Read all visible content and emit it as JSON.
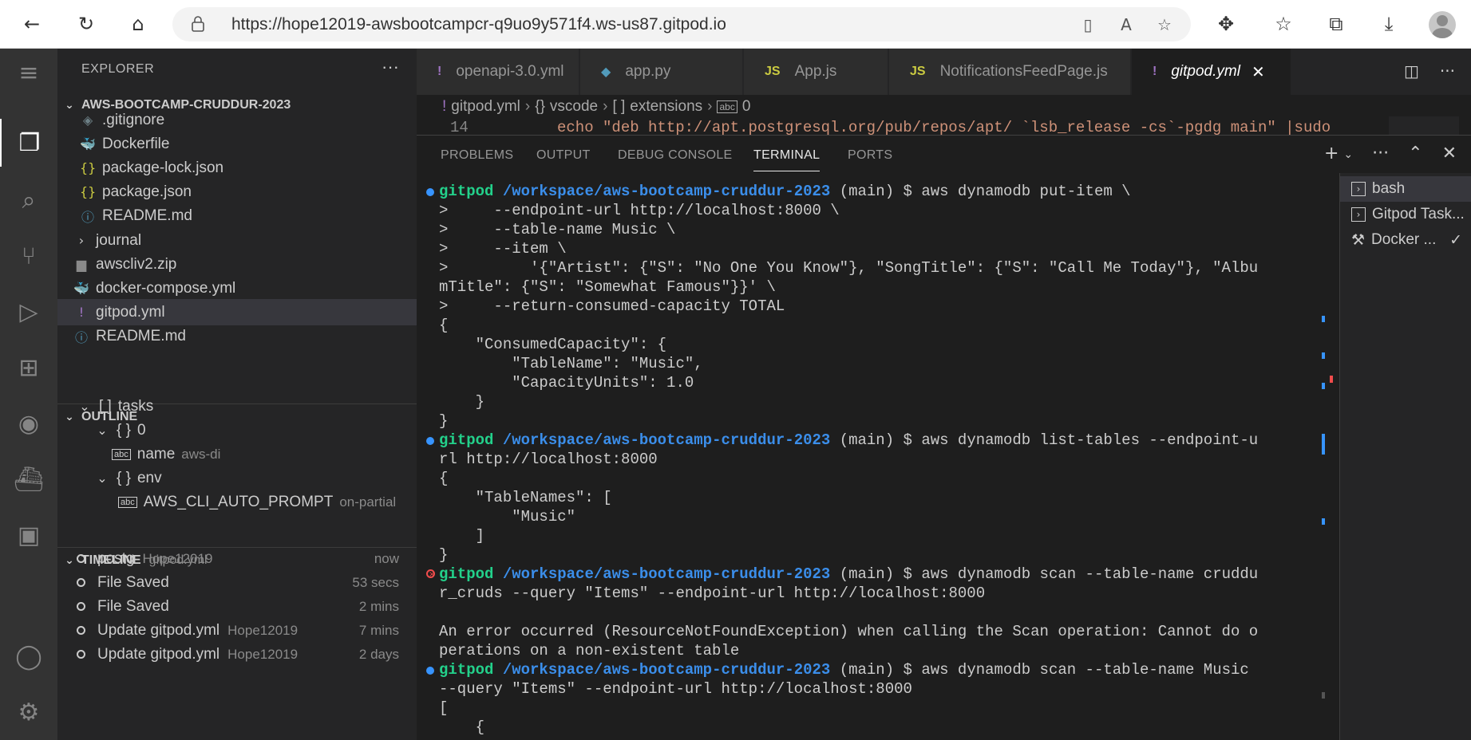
{
  "browser": {
    "url": "https://hope12019-awsbootcampcr-q9uo9y571f4.ws-us87.gitpod.io",
    "icons": [
      "back-icon",
      "refresh-icon",
      "home-icon",
      "lock-icon",
      "tab-icon",
      "read-aloud-icon",
      "add-favorite-icon",
      "extensions-icon",
      "favorites-icon",
      "collections-icon",
      "downloads-icon",
      "profile-avatar"
    ]
  },
  "activity_bar": {
    "icons": [
      "menu-icon",
      "explorer-icon",
      "search-icon",
      "source-control-icon",
      "run-debug-icon",
      "extensions-icon",
      "github-icon",
      "docker-icon",
      "api-icon",
      "account-icon",
      "settings-icon"
    ]
  },
  "sidebar": {
    "title": "EXPLORER",
    "more": "···",
    "root": "AWS-BOOTCAMP-CRUDDUR-2023",
    "files": [
      {
        "name": ".gitignore",
        "icon": "◈",
        "color": "#6d8086"
      },
      {
        "name": "Dockerfile",
        "icon": "🐳",
        "color": "#519aba"
      },
      {
        "name": "package-lock.json",
        "icon": "{}",
        "color": "#cbcb41"
      },
      {
        "name": "package.json",
        "icon": "{}",
        "color": "#cbcb41"
      },
      {
        "name": "README.md",
        "icon": "ⓘ",
        "color": "#519aba"
      },
      {
        "name": "journal",
        "icon": "›",
        "color": "#cccccc"
      },
      {
        "name": "awscliv2.zip",
        "icon": "▆",
        "color": "#8a8a8a"
      },
      {
        "name": "docker-compose.yml",
        "icon": "🐳",
        "color": "#e06c9f"
      },
      {
        "name": "gitpod.yml",
        "icon": "!",
        "color": "#a074c4"
      },
      {
        "name": "README.md",
        "icon": "ⓘ",
        "color": "#519aba"
      }
    ],
    "outline": {
      "title": "OUTLINE",
      "items": [
        {
          "label": "tasks",
          "prefix": "[ ]",
          "desc": ""
        },
        {
          "label": "0",
          "prefix": "{ }",
          "desc": ""
        },
        {
          "label": "name",
          "prefix": "abc",
          "desc": "aws-di"
        },
        {
          "label": "env",
          "prefix": "{ }",
          "desc": ""
        },
        {
          "label": "AWS_CLI_AUTO_PROMPT",
          "prefix": "abc",
          "desc": "on-partial"
        }
      ]
    },
    "timeline": {
      "title": "TIMELINE",
      "file": "gitpod.yml",
      "items": [
        {
          "label": "postg",
          "author": "Hope12019",
          "when": "now"
        },
        {
          "label": "File Saved",
          "author": "",
          "when": "53 secs"
        },
        {
          "label": "File Saved",
          "author": "",
          "when": "2 mins"
        },
        {
          "label": "Update gitpod.yml",
          "author": "Hope12019",
          "when": "7 mins"
        },
        {
          "label": "Update gitpod.yml",
          "author": "Hope12019",
          "when": "2 days"
        }
      ]
    }
  },
  "editor": {
    "tabs": [
      {
        "label": "openapi-3.0.yml",
        "icon": "!",
        "color": "#a074c4"
      },
      {
        "label": "app.py",
        "icon": "◆",
        "color": "#519aba"
      },
      {
        "label": "App.js",
        "icon": "JS",
        "color": "#cbcb41"
      },
      {
        "label": "NotificationsFeedPage.js",
        "icon": "JS",
        "color": "#cbcb41"
      },
      {
        "label": "gitpod.yml",
        "icon": "!",
        "color": "#a074c4"
      }
    ],
    "close_glyph": "✕",
    "breadcrumb": [
      "gitpod.yml",
      "vscode",
      "extensions",
      "0"
    ],
    "breadcrumb_icons": [
      "!",
      "{}",
      "[ ]",
      "abc"
    ],
    "line_number": "14",
    "line_text": "echo \"deb http://apt.postgresql.org/pub/repos/apt/ `lsb_release -cs`-pgdg main\" |sudo"
  },
  "panel": {
    "tabs": [
      "PROBLEMS",
      "OUTPUT",
      "DEBUG CONSOLE",
      "TERMINAL",
      "PORTS"
    ],
    "active_tab": "TERMINAL",
    "terminals": [
      {
        "label": "bash"
      },
      {
        "label": "Gitpod Task..."
      },
      {
        "label": "Docker ..."
      }
    ]
  },
  "terminal": {
    "prompt_user": "gitpod",
    "prompt_path": "/workspace/aws-bootcamp-cruddur-2023",
    "prompt_branch": " (main) $ ",
    "lines": [
      {
        "mark": "ok",
        "cmd": "aws dynamodb put-item \\"
      },
      {
        "text": ">     --endpoint-url http://localhost:8000 \\"
      },
      {
        "text": ">     --table-name Music \\"
      },
      {
        "text": ">     --item \\"
      },
      {
        "text": ">         '{\"Artist\": {\"S\": \"No One You Know\"}, \"SongTitle\": {\"S\": \"Call Me Today\"}, \"Albu"
      },
      {
        "text": "mTitle\": {\"S\": \"Somewhat Famous\"}}' \\"
      },
      {
        "text": ">     --return-consumed-capacity TOTAL"
      },
      {
        "text": "{"
      },
      {
        "text": "    \"ConsumedCapacity\": {"
      },
      {
        "text": "        \"TableName\": \"Music\","
      },
      {
        "text": "        \"CapacityUnits\": 1.0"
      },
      {
        "text": "    }"
      },
      {
        "text": "}"
      },
      {
        "mark": "ok",
        "cmd": "aws dynamodb list-tables --endpoint-u"
      },
      {
        "text": "rl http://localhost:8000"
      },
      {
        "text": "{"
      },
      {
        "text": "    \"TableNames\": ["
      },
      {
        "text": "        \"Music\""
      },
      {
        "text": "    ]"
      },
      {
        "text": "}"
      },
      {
        "mark": "err",
        "cmd": "aws dynamodb scan --table-name cruddu"
      },
      {
        "text": "r_cruds --query \"Items\" --endpoint-url http://localhost:8000"
      },
      {
        "text": ""
      },
      {
        "text": "An error occurred (ResourceNotFoundException) when calling the Scan operation: Cannot do o"
      },
      {
        "text": "perations on a non-existent table"
      },
      {
        "mark": "ok",
        "cmd": "aws dynamodb scan --table-name Music"
      },
      {
        "text": "--query \"Items\" --endpoint-url http://localhost:8000"
      },
      {
        "text": "["
      },
      {
        "text": "    {"
      }
    ]
  }
}
